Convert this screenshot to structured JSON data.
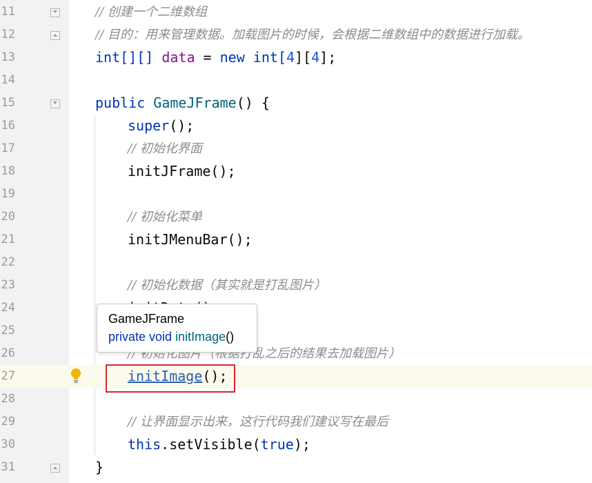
{
  "editor": {
    "lines": [
      {
        "number": "11",
        "comment": "// 创建一个二维数组"
      },
      {
        "number": "12",
        "comment": "// 目的：用来管理数据。加载图片的时候，会根据二维数组中的数据进行加载。"
      },
      {
        "number": "13",
        "type": "int[][] ",
        "field": "data",
        "eq": " = ",
        "new_kw": "new",
        "type2": " int[",
        "n1": "4",
        "mid": "][",
        "n2": "4",
        "end": "];"
      },
      {
        "number": "14"
      },
      {
        "number": "15",
        "kw": "public ",
        "name": "GameJFrame",
        "rest": "() {"
      },
      {
        "number": "16",
        "kw": "super",
        "rest": "();"
      },
      {
        "number": "17",
        "comment": "// 初始化界面"
      },
      {
        "number": "18",
        "text": "initJFrame();"
      },
      {
        "number": "19"
      },
      {
        "number": "20",
        "comment": "// 初始化菜单"
      },
      {
        "number": "21",
        "text": "initJMenuBar();"
      },
      {
        "number": "22"
      },
      {
        "number": "23",
        "comment": "// 初始化数据（其实就是打乱图片）"
      },
      {
        "number": "24",
        "text": "initData();"
      },
      {
        "number": "25"
      },
      {
        "number": "26",
        "comment": "// 初始化图片（根据打乱之后的结果去加载图片）"
      },
      {
        "number": "27",
        "link": "initImage",
        "rest": "();"
      },
      {
        "number": "28"
      },
      {
        "number": "29",
        "comment": "// 让界面显示出来，这行代码我们建议写在最后"
      },
      {
        "number": "30",
        "kw": "this",
        "mid": ".setVisible(",
        "val": "true",
        "rest": ");"
      },
      {
        "number": "31",
        "text": "}"
      }
    ]
  },
  "tooltip": {
    "class_name": "GameJFrame",
    "modifiers": "private void ",
    "method": "initImage",
    "params": "()"
  },
  "icons": {
    "intention": "lightbulb-icon",
    "fold": "fold-marker-icon"
  },
  "colors": {
    "keyword": "#0033b3",
    "field": "#871094",
    "number": "#1750eb",
    "method_decl": "#00627a",
    "comment": "#8c8c8c",
    "highlight_box": "#d4262a",
    "current_line": "#fcfaed"
  }
}
